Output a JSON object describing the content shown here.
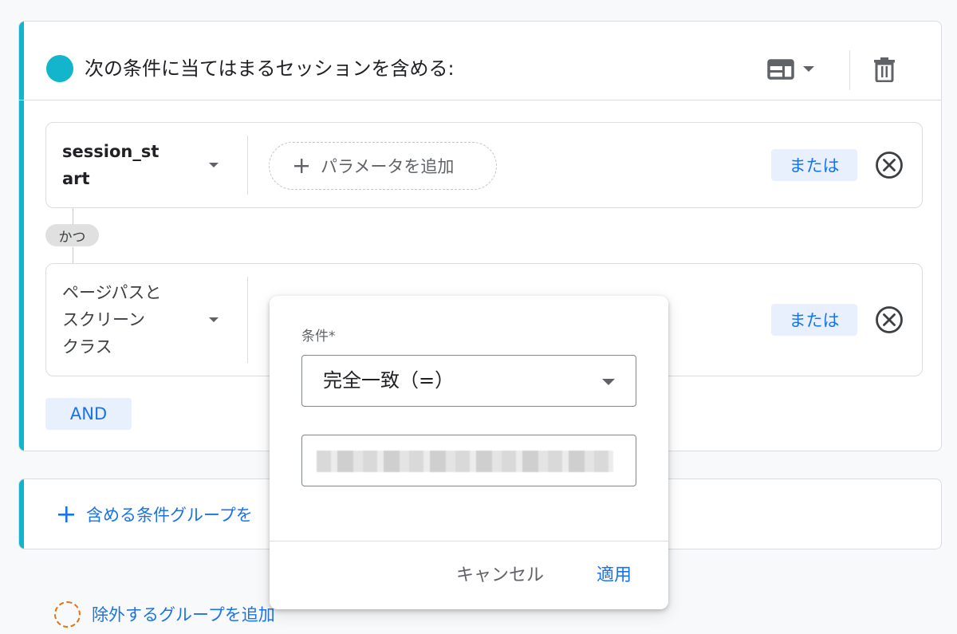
{
  "include_group": {
    "title": "次の条件に当てはまるセッションを含める:",
    "icons": {
      "dot": "teal-circle-icon",
      "layout": "layout-icon",
      "delete": "trash-icon"
    },
    "conditions": [
      {
        "event": "session_start",
        "add_param_label": "パラメータを追加",
        "or_label": "または"
      },
      {
        "event": "ページパスとスクリーン クラス",
        "or_label": "または"
      }
    ],
    "connector_label": "かつ",
    "and_button": "AND"
  },
  "add_include_group_label": "含める条件グループを",
  "add_exclude_group_label": "除外するグループを追加",
  "popup": {
    "condition_label": "条件*",
    "operator_value": "完全一致（=）",
    "value_input": "",
    "cancel": "キャンセル",
    "apply": "適用"
  },
  "colors": {
    "accent": "#12b5cb",
    "link": "#1a73e8",
    "chip_bg": "#e8f0fe",
    "exclude": "#e8710a"
  }
}
